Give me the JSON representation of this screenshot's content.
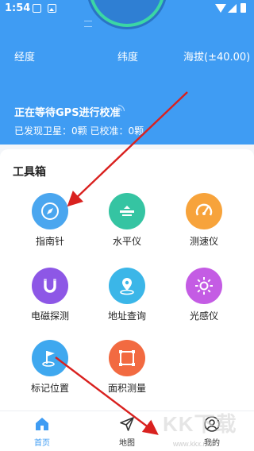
{
  "status_bar": {
    "time": "1:54"
  },
  "coords": {
    "lon_label": "经度",
    "lat_label": "纬度",
    "alt_label": "海拔(±40.00)"
  },
  "gps": {
    "title": "正在等待GPS进行校准",
    "stats": "已发现卫星：0颗    已校准：0颗"
  },
  "tools": {
    "title": "工具箱",
    "items": [
      {
        "label": "指南针",
        "icon": "compass-icon",
        "color": "#4aa6ef"
      },
      {
        "label": "水平仪",
        "icon": "level-icon",
        "color": "#35c4a2"
      },
      {
        "label": "测速仪",
        "icon": "speedometer-icon",
        "color": "#f7a33b"
      },
      {
        "label": "电磁探测",
        "icon": "magnet-icon",
        "color": "#8d57e6"
      },
      {
        "label": "地址查询",
        "icon": "location-pin-icon",
        "color": "#3bb6e8"
      },
      {
        "label": "光感仪",
        "icon": "sun-icon",
        "color": "#c45ce4"
      },
      {
        "label": "标记位置",
        "icon": "flag-icon",
        "color": "#3fa8ef"
      },
      {
        "label": "面积测量",
        "icon": "area-icon",
        "color": "#f26a41"
      }
    ]
  },
  "nav": {
    "items": [
      {
        "label": "首页",
        "icon": "home-icon",
        "active": true
      },
      {
        "label": "地图",
        "icon": "send-icon",
        "active": false
      },
      {
        "label": "我的",
        "icon": "user-icon",
        "active": false
      }
    ]
  },
  "watermark": {
    "text": "KK下载",
    "url": "www.kkx.net"
  },
  "colors": {
    "primary": "#3f9cf3",
    "annotation_arrow": "#d9211f"
  }
}
